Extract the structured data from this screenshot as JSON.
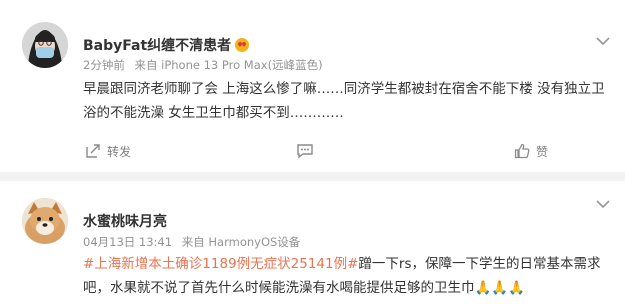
{
  "posts": [
    {
      "username": "BabyFat纠缠不清患者",
      "time": "2分钟前",
      "source": "来自 iPhone 13 Pro Max(远峰蓝色)",
      "body": "早晨跟同济老师聊了会 上海这么惨了嘛……同济学生都被封在宿舍不能下楼 没有独立卫浴的不能洗澡 女生卫生巾都买不到…………",
      "actions": {
        "repost": "转发",
        "comment": "",
        "like": "赞"
      }
    },
    {
      "username": "水蜜桃味月亮",
      "time": "04月13日 13:41",
      "source": "来自 HarmonyOS设备",
      "topic": "#上海新增本土确诊1189例无症状25141例#",
      "body": "蹭一下rs，保障一下学生的日常基本需求吧，水果就不说了首先什么时候能洗澡有水喝能提供足够的卫生巾🙏🙏🙏"
    }
  ],
  "colors": {
    "topic": "#eb7350",
    "meta": "#939393",
    "background": "#f2f2f2"
  },
  "icons": [
    "more-icon",
    "repost-icon",
    "comment-icon",
    "like-icon",
    "heart-eyes-emoji-icon"
  ]
}
